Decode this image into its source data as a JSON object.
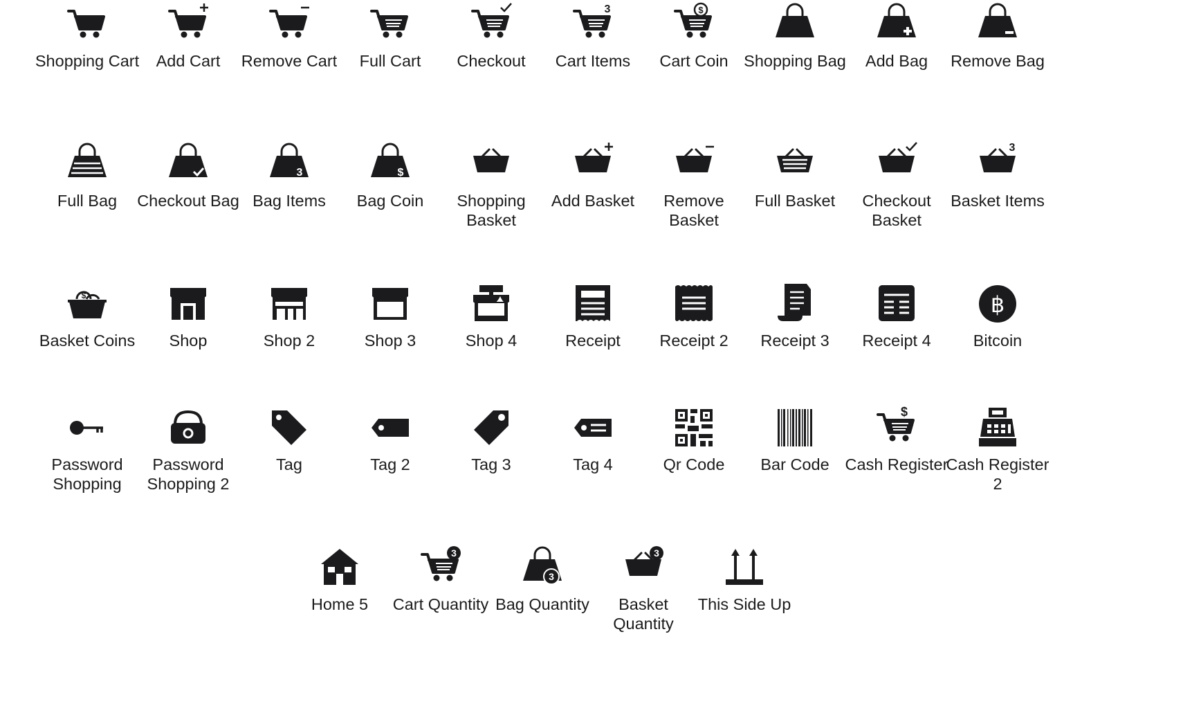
{
  "icons": [
    {
      "label": "Shopping Cart",
      "icon": "shopping-cart-icon"
    },
    {
      "label": "Add Cart",
      "icon": "add-cart-icon"
    },
    {
      "label": "Remove Cart",
      "icon": "remove-cart-icon"
    },
    {
      "label": "Full Cart",
      "icon": "full-cart-icon"
    },
    {
      "label": "Checkout",
      "icon": "checkout-icon"
    },
    {
      "label": "Cart Items",
      "icon": "cart-items-icon"
    },
    {
      "label": "Cart Coin",
      "icon": "cart-coin-icon"
    },
    {
      "label": "Shopping Bag",
      "icon": "shopping-bag-icon"
    },
    {
      "label": "Add Bag",
      "icon": "add-bag-icon"
    },
    {
      "label": "Remove Bag",
      "icon": "remove-bag-icon"
    },
    {
      "label": "Full Bag",
      "icon": "full-bag-icon"
    },
    {
      "label": "Checkout Bag",
      "icon": "checkout-bag-icon"
    },
    {
      "label": "Bag Items",
      "icon": "bag-items-icon"
    },
    {
      "label": "Bag Coin",
      "icon": "bag-coin-icon"
    },
    {
      "label": "Shopping Basket",
      "icon": "shopping-basket-icon"
    },
    {
      "label": "Add Basket",
      "icon": "add-basket-icon"
    },
    {
      "label": "Remove Basket",
      "icon": "remove-basket-icon"
    },
    {
      "label": "Full Basket",
      "icon": "full-basket-icon"
    },
    {
      "label": "Checkout Basket",
      "icon": "checkout-basket-icon"
    },
    {
      "label": "Basket Items",
      "icon": "basket-items-icon"
    },
    {
      "label": "Basket Coins",
      "icon": "basket-coins-icon"
    },
    {
      "label": "Shop",
      "icon": "shop-icon"
    },
    {
      "label": "Shop 2",
      "icon": "shop-2-icon"
    },
    {
      "label": "Shop 3",
      "icon": "shop-3-icon"
    },
    {
      "label": "Shop 4",
      "icon": "shop-4-icon"
    },
    {
      "label": "Receipt",
      "icon": "receipt-icon"
    },
    {
      "label": "Receipt 2",
      "icon": "receipt-2-icon"
    },
    {
      "label": "Receipt 3",
      "icon": "receipt-3-icon"
    },
    {
      "label": "Receipt 4",
      "icon": "receipt-4-icon"
    },
    {
      "label": "Bitcoin",
      "icon": "bitcoin-icon"
    },
    {
      "label": "Password Shopping",
      "icon": "password-shopping-icon"
    },
    {
      "label": "Password Shopping 2",
      "icon": "password-shopping-2-icon"
    },
    {
      "label": "Tag",
      "icon": "tag-icon"
    },
    {
      "label": "Tag 2",
      "icon": "tag-2-icon"
    },
    {
      "label": "Tag 3",
      "icon": "tag-3-icon"
    },
    {
      "label": "Tag 4",
      "icon": "tag-4-icon"
    },
    {
      "label": "Qr Code",
      "icon": "qr-code-icon"
    },
    {
      "label": "Bar Code",
      "icon": "bar-code-icon"
    },
    {
      "label": "Cash Register",
      "icon": "cash-register-icon"
    },
    {
      "label": "Cash Register 2",
      "icon": "cash-register-2-icon"
    },
    {
      "label": "Home 5",
      "icon": "home-5-icon"
    },
    {
      "label": "Cart Quantity",
      "icon": "cart-quantity-icon"
    },
    {
      "label": "Bag Quantity",
      "icon": "bag-quantity-icon"
    },
    {
      "label": "Basket Quantity",
      "icon": "basket-quantity-icon"
    },
    {
      "label": "This Side Up",
      "icon": "this-side-up-icon"
    }
  ],
  "badge_text": {
    "cart_items": "3",
    "bag_items": "3",
    "basket_items": "3",
    "quantity": "3",
    "coin": "$",
    "cash": "$"
  },
  "colors": {
    "icon": "#1b1b1d",
    "background": "#ffffff"
  }
}
